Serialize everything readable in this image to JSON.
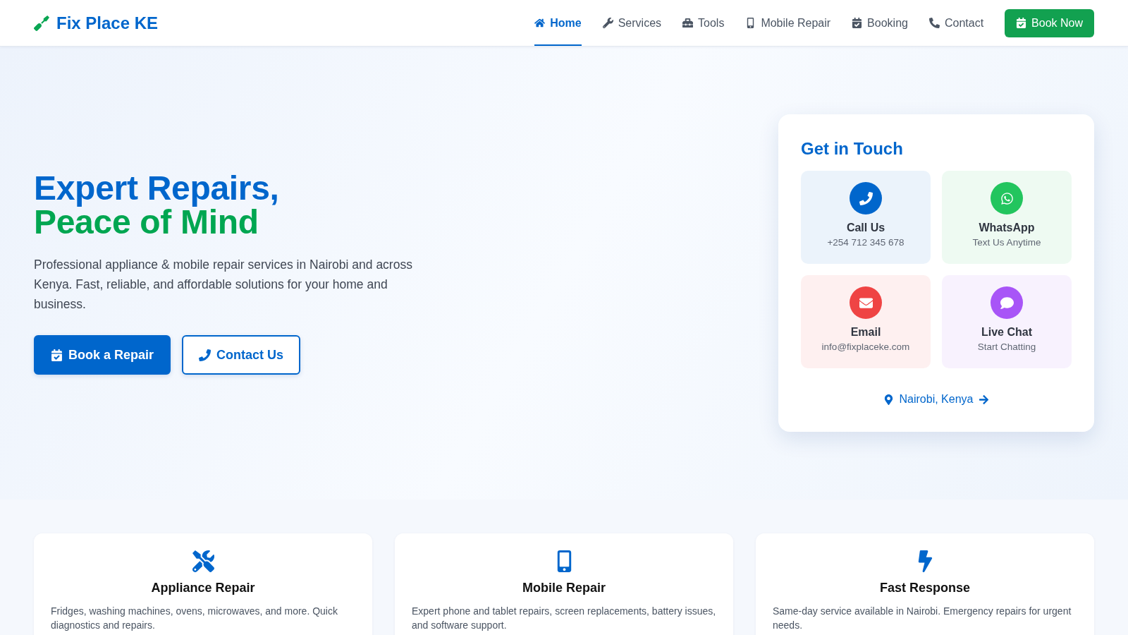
{
  "header": {
    "logo": {
      "text": "Fix Place KE"
    },
    "nav": [
      {
        "kind": "home",
        "label": "Home",
        "selected": true
      },
      {
        "kind": "wrench",
        "label": "Services",
        "selected": false
      },
      {
        "kind": "toolbox",
        "label": "Tools",
        "selected": false
      },
      {
        "kind": "mobile",
        "label": "Mobile Repair",
        "selected": false
      },
      {
        "kind": "calendar",
        "label": "Booking",
        "selected": false
      },
      {
        "kind": "phone",
        "label": "Contact",
        "selected": false
      }
    ],
    "cta": {
      "label": "Book Now"
    }
  },
  "hero": {
    "title": {
      "line_1": "Expert Repairs,",
      "line_2": "Peace of Mind"
    },
    "description": "Professional appliance & mobile repair services in Nairobi and across Kenya. Fast, reliable, and affordable solutions for your home and business.",
    "buttons": [
      {
        "kind": "primary",
        "label": "Book a Repair"
      },
      {
        "kind": "outline",
        "label": "Contact Us"
      }
    ]
  },
  "contact_card": {
    "title": "Get in Touch",
    "options": [
      {
        "kind": "phone",
        "title": "Call Us",
        "detail": "+254 712 345 678",
        "color": "#0066cc"
      },
      {
        "kind": "whatsapp",
        "title": "WhatsApp",
        "detail": "Text Us Anytime",
        "color": "#22c55e"
      },
      {
        "kind": "email",
        "title": "Email",
        "detail": "info@fixplaceke.com",
        "color": "#ef4444"
      },
      {
        "kind": "chat",
        "title": "Live Chat",
        "detail": "Start Chatting",
        "color": "#a855f7"
      }
    ],
    "location": {
      "label": "Nairobi, Kenya"
    }
  },
  "features": [
    {
      "kind": "appliance",
      "title": "Appliance Repair",
      "description": "Fridges, washing machines, ovens, microwaves, and more. Quick diagnostics and repairs."
    },
    {
      "kind": "mobile",
      "title": "Mobile Repair",
      "description": "Expert phone and tablet repairs, screen replacements, battery issues, and software support."
    },
    {
      "kind": "fast",
      "title": "Fast Response",
      "description": "Same-day service available in Nairobi. Emergency repairs for urgent needs."
    }
  ]
}
